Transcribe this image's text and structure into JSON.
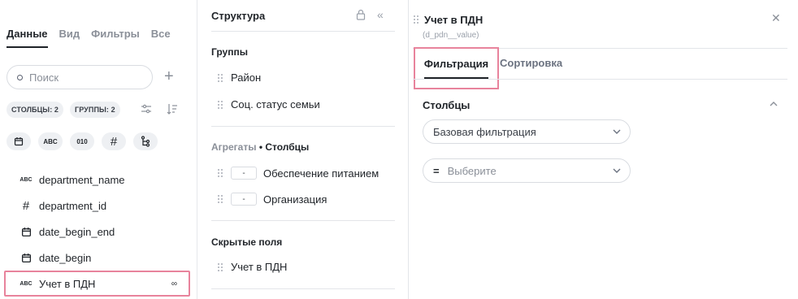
{
  "left": {
    "tabs": [
      "Данные",
      "Вид",
      "Фильтры",
      "Все"
    ],
    "active_tab": 0,
    "search_placeholder": "Поиск",
    "chips": [
      "СТОЛБЦЫ: 2",
      "ГРУППЫ: 2"
    ],
    "type_filters": [
      "date",
      "ABC",
      "010",
      "#",
      "tree"
    ],
    "fields": [
      {
        "icon": "ABC",
        "label": "department_name"
      },
      {
        "icon": "#",
        "label": "department_id"
      },
      {
        "icon": "date",
        "label": "date_begin_end"
      },
      {
        "icon": "date",
        "label": "date_begin"
      },
      {
        "icon": "ABC",
        "label": "Учет в ПДН",
        "selected": true
      }
    ]
  },
  "middle": {
    "title": "Структура",
    "groups_title": "Группы",
    "groups": [
      "Район",
      "Соц. статус семьи"
    ],
    "aggregates_label": "Агрегаты",
    "columns_label": "• Столбцы",
    "columns": [
      {
        "agg": "-",
        "label": "Обеспечение питанием"
      },
      {
        "agg": "-",
        "label": "Организация"
      }
    ],
    "hidden_title": "Скрытые поля",
    "hidden": [
      "Учет в ПДН"
    ]
  },
  "right": {
    "title": "Учет в ПДН",
    "subtitle": "(d_pdn__value)",
    "tabs": [
      "Фильтрация",
      "Сортировка"
    ],
    "section": "Столбцы",
    "filter_type": "Базовая фильтрация",
    "operator": "=",
    "value_placeholder": "Выберите"
  }
}
